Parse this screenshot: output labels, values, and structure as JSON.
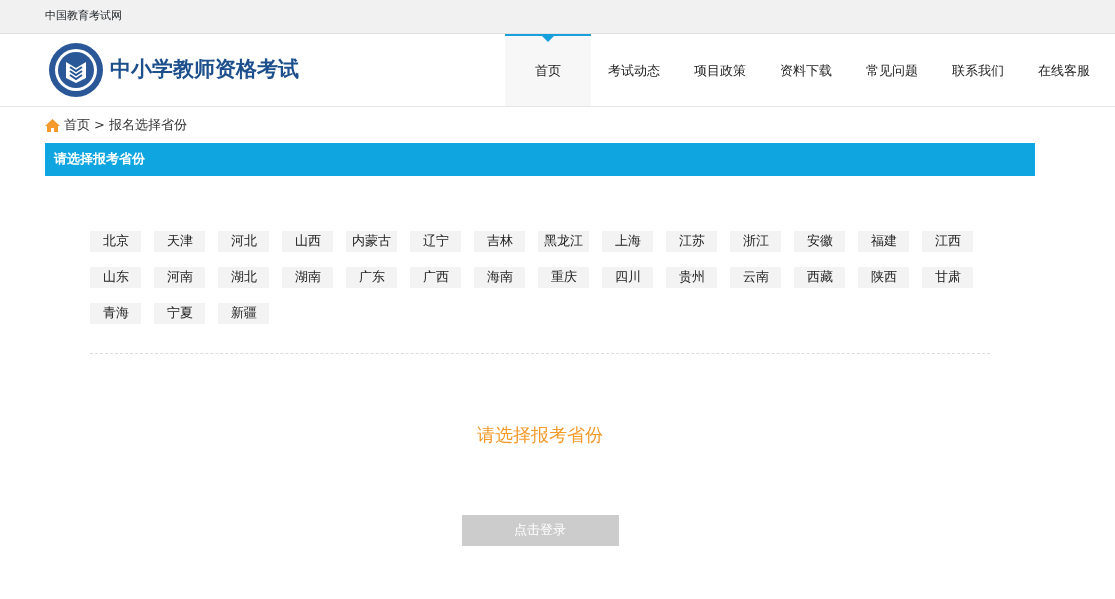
{
  "top_bar": {
    "site_link": "中国教育考试网"
  },
  "header": {
    "title": "中小学教师资格考试"
  },
  "nav": [
    {
      "label": "首页",
      "selected": true
    },
    {
      "label": "考试动态",
      "selected": false
    },
    {
      "label": "项目政策",
      "selected": false
    },
    {
      "label": "资料下载",
      "selected": false
    },
    {
      "label": "常见问题",
      "selected": false
    },
    {
      "label": "联系我们",
      "selected": false
    },
    {
      "label": "在线客服",
      "selected": false
    }
  ],
  "breadcrumb": {
    "home": "首页",
    "separator": ">",
    "current": "报名选择省份"
  },
  "panel": {
    "title": "请选择报考省份"
  },
  "provinces": [
    {
      "label": "北京",
      "selected": false
    },
    {
      "label": "天津",
      "selected": false
    },
    {
      "label": "河北",
      "selected": false
    },
    {
      "label": "山西",
      "selected": false
    },
    {
      "label": "内蒙古",
      "selected": false
    },
    {
      "label": "辽宁",
      "selected": false
    },
    {
      "label": "吉林",
      "selected": false
    },
    {
      "label": "黑龙江",
      "selected": false
    },
    {
      "label": "上海",
      "selected": false
    },
    {
      "label": "江苏",
      "selected": false
    },
    {
      "label": "浙江",
      "selected": false
    },
    {
      "label": "安徽",
      "selected": false
    },
    {
      "label": "福建",
      "selected": false
    },
    {
      "label": "江西",
      "selected": false
    },
    {
      "label": "山东",
      "selected": false
    },
    {
      "label": "河南",
      "selected": false
    },
    {
      "label": "湖北",
      "selected": false
    },
    {
      "label": "湖南",
      "selected": false
    },
    {
      "label": "广东",
      "selected": false
    },
    {
      "label": "广西",
      "selected": false
    },
    {
      "label": "海南",
      "selected": false
    },
    {
      "label": "重庆",
      "selected": false
    },
    {
      "label": "四川",
      "selected": false
    },
    {
      "label": "贵州",
      "selected": false
    },
    {
      "label": "云南",
      "selected": false
    },
    {
      "label": "西藏",
      "selected": false
    },
    {
      "label": "陕西",
      "selected": false
    },
    {
      "label": "甘肃",
      "selected": false
    },
    {
      "label": "青海",
      "selected": false
    },
    {
      "label": "宁夏",
      "selected": false
    },
    {
      "label": "新疆",
      "selected": false
    }
  ],
  "prompt": "请选择报考省份",
  "login_button": {
    "label": "点击登录",
    "disabled": true
  }
}
